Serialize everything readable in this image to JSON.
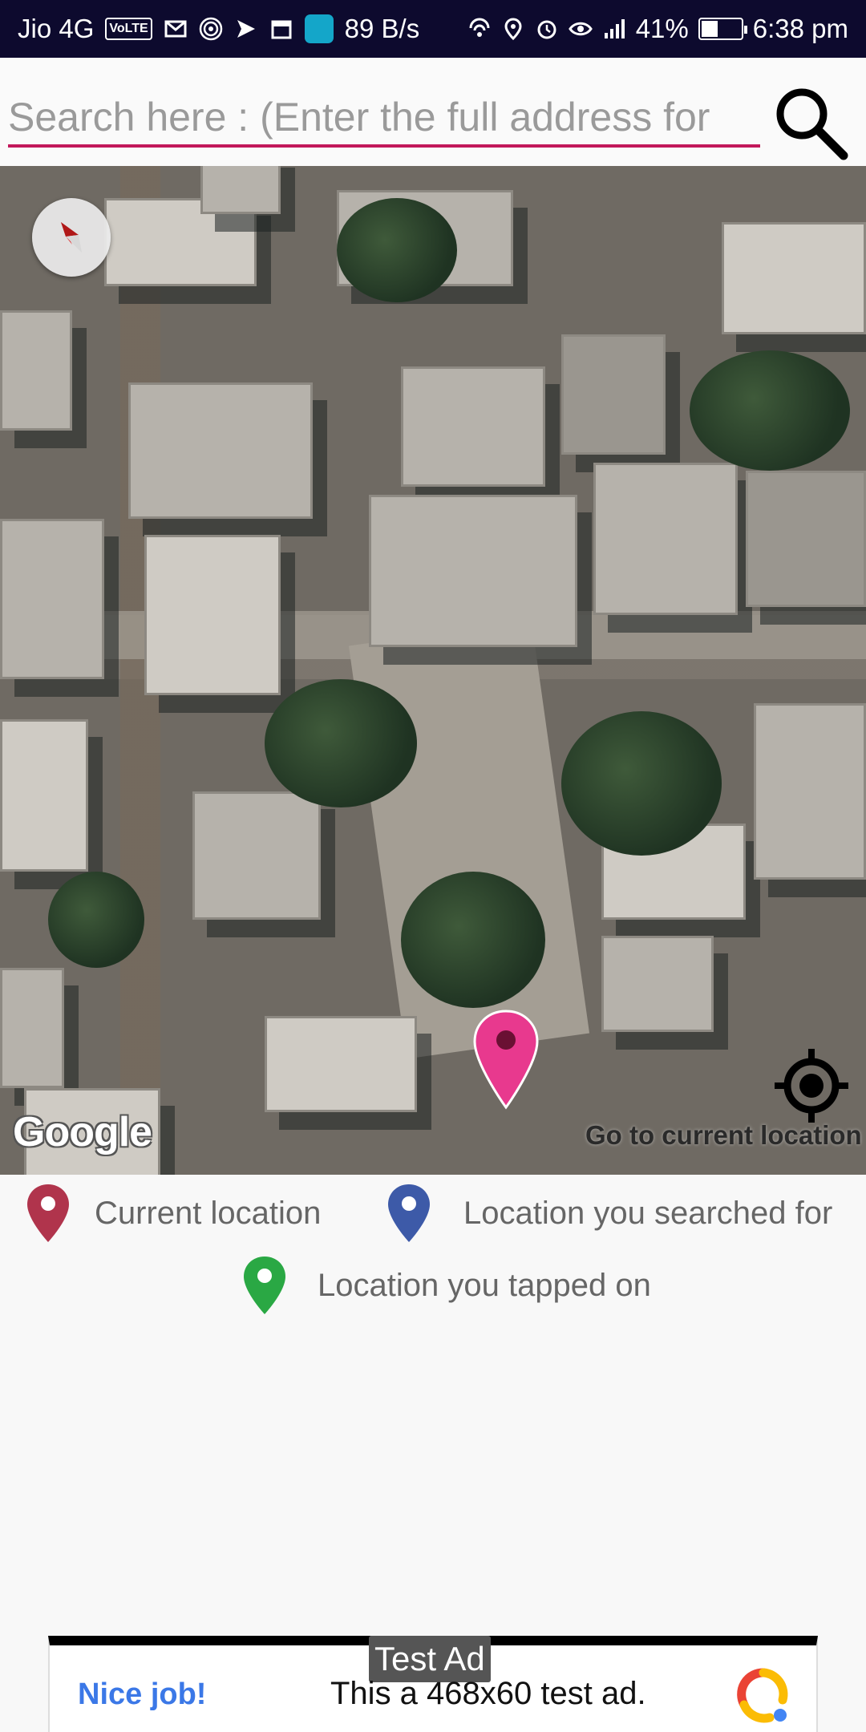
{
  "status_bar": {
    "carrier": "Jio 4G",
    "volte_badge": "VoLTE",
    "speed": "89 B/s",
    "battery": "41%",
    "battery_level": 0.41,
    "time": "6:38 pm"
  },
  "search": {
    "placeholder": "Search here : (Enter the full address for"
  },
  "map": {
    "attribution": "Google",
    "locate_label": "Go to current location"
  },
  "legend": {
    "current": "Current location",
    "searched": "Location you searched for",
    "tapped": "Location you tapped on",
    "colors": {
      "current": "#b0344c",
      "searched": "#3d5aa8",
      "tapped": "#2aa844",
      "selected_pin": "#e8398e"
    }
  },
  "ad": {
    "tag": "Test Ad",
    "headline": "Nice job!",
    "body": "This a 468x60 test ad."
  },
  "colors": {
    "accent": "#c2185b",
    "status_bar": "#0d0a2e"
  }
}
